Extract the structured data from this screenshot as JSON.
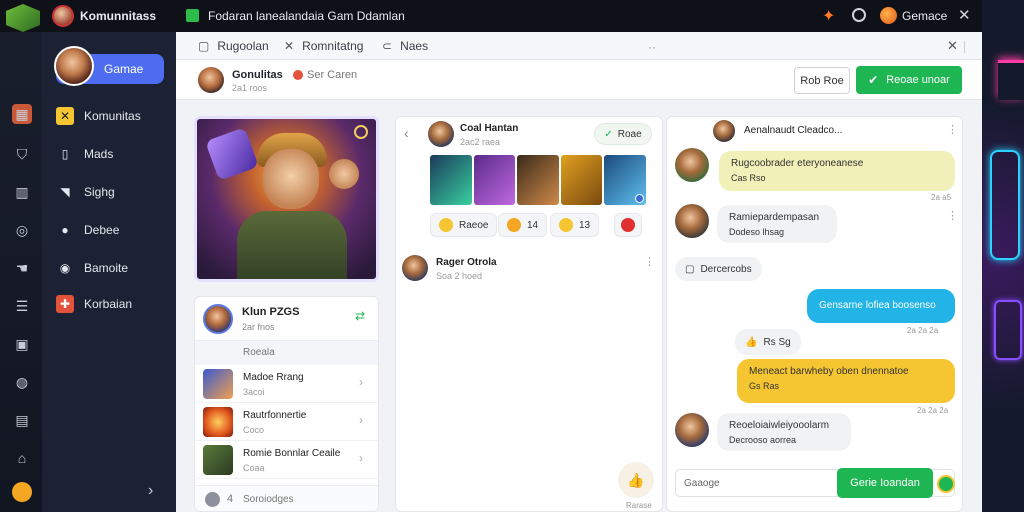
{
  "titlebar": {
    "app_title": "Komunnitass",
    "tab_title": "Fodaran lanealandaia  Gam Ddamlan",
    "right_label": "Gemace"
  },
  "nav": {
    "user_label": "Gamae",
    "items": [
      {
        "label": "Komunitas",
        "icon": "grid-icon",
        "color": "#f5c532"
      },
      {
        "label": "Mads",
        "icon": "tablet-icon",
        "color": "#c8ccd6"
      },
      {
        "label": "Sighg",
        "icon": "megaphone-icon",
        "color": "#c8ccd6"
      },
      {
        "label": "Debee",
        "icon": "person-icon",
        "color": "#c8ccd6"
      },
      {
        "label": "Bamoite",
        "icon": "profile-icon",
        "color": "#c8ccd6"
      },
      {
        "label": "Korbaian",
        "icon": "badge-icon",
        "color": "#e3533b"
      }
    ]
  },
  "tabs": [
    {
      "label": "Rugoolan",
      "icon": "page-icon"
    },
    {
      "label": "Romnitatng",
      "icon": "close-icon"
    },
    {
      "label": "Naes",
      "icon": "link-icon"
    }
  ],
  "header": {
    "name": "Gonulitas",
    "secondary": "Ser Caren",
    "sub": "2a1 roos",
    "btn_secondary": "Rob Roe",
    "btn_primary": "Reoae unoar"
  },
  "friends": {
    "top_name": "Klun PZGS",
    "top_sub": "2ar fnos",
    "section": "Roeala",
    "items": [
      {
        "name": "Madoe Rrang",
        "sub": "3acoi"
      },
      {
        "name": "Rautrfonnertie",
        "sub": "Coco"
      },
      {
        "name": "Romie Bonnlar Ceaile",
        "sub": "Coaa"
      }
    ],
    "bottom": "Soroiodges"
  },
  "feed": {
    "post1_name": "Coal Hantan",
    "post1_sub": "2ac2 raea",
    "pill": "Roae",
    "reactions": [
      {
        "label": "Raeoe",
        "color": "#f5c532"
      },
      {
        "label": "14",
        "color": "#f5a623"
      },
      {
        "label": "13",
        "color": "#f5c532"
      },
      {
        "label": "",
        "color": "#e02f2f"
      }
    ],
    "post2_name": "Rager Otrola",
    "post2_sub": "Soa 2 hoed",
    "fab_label": "Rarase"
  },
  "chat": {
    "header_name": "Aenalnaudt Cleadco...",
    "messages": [
      {
        "text": "Rugcoobrader eteryoneanese",
        "sub": "Cas Rso",
        "time": "2a a5"
      },
      {
        "text": "Ramiepardempasan",
        "sub": "Dodeso lhsag",
        "time": ""
      },
      {
        "text": "Dercercobs",
        "sub": "",
        "time": ""
      },
      {
        "text": "Gensarne lofiea boosenso",
        "sub": "",
        "time": "2a 2a 2a"
      },
      {
        "text": "Rs Sg",
        "sub": "",
        "time": ""
      },
      {
        "text": "Meneact barwheby oben dnennatoe",
        "sub": "Gs Ras",
        "time": "2a 2a 2a"
      },
      {
        "text": "Reoeloiaiwleiyooolarm",
        "sub": "Decrooso aorrea",
        "time": ""
      }
    ],
    "composer_placeholder": "Gaaoge",
    "send_label": "Gerie Ioandan"
  }
}
